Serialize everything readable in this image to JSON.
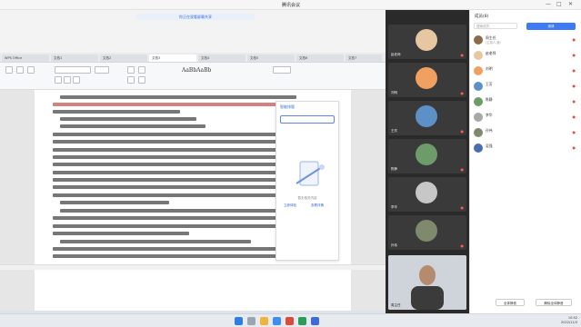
{
  "meeting": {
    "title": "腾讯会议",
    "controls": [
      "—",
      "□",
      "✕"
    ]
  },
  "share_bar": {
    "label": "你正在观看屏幕共享"
  },
  "wps": {
    "tabs": [
      "WPS Office",
      "文档1",
      "文档2",
      "文档3",
      "文档4",
      "文档5",
      "文档6",
      "文档7"
    ],
    "style_sample": "AaBbAaBb",
    "panel": {
      "header": "智能排版",
      "caption": "暂无相关内容",
      "link_left": "立即体验",
      "link_right": "查看详情"
    }
  },
  "taskbar": {
    "app_label": "WPS Office"
  },
  "host_taskbar": {
    "time": "10:52",
    "date": "2022/11/3"
  },
  "videos": {
    "tiles": [
      {
        "name": "赵老师",
        "color": "#e6c7a1"
      },
      {
        "name": "刘明",
        "color": "#f0a060"
      },
      {
        "name": "王芳",
        "color": "#5e90c8"
      },
      {
        "name": "陈静",
        "color": "#6e9b6a"
      },
      {
        "name": "李华",
        "color": "#c7c7c7"
      },
      {
        "name": "孙伟",
        "color": "#7f8a6d"
      }
    ],
    "speaker": "周主任"
  },
  "members": {
    "header": "成员(8)",
    "search_placeholder": "搜索成员",
    "invite": "邀请",
    "list": [
      {
        "name": "周主任",
        "role": "(主持人,我)",
        "color": "#8b6b4a"
      },
      {
        "name": "赵老师",
        "role": "",
        "color": "#e6c7a1"
      },
      {
        "name": "刘明",
        "role": "",
        "color": "#f0a060"
      },
      {
        "name": "王芳",
        "role": "",
        "color": "#5e90c8"
      },
      {
        "name": "陈静",
        "role": "",
        "color": "#6e9b6a"
      },
      {
        "name": "李华",
        "role": "",
        "color": "#a8a8a8"
      },
      {
        "name": "孙伟",
        "role": "",
        "color": "#7f8a6d"
      },
      {
        "name": "吴强",
        "role": "",
        "color": "#4a6fb0"
      }
    ],
    "footer_left": "全体静音",
    "footer_right": "解除全体静音"
  }
}
